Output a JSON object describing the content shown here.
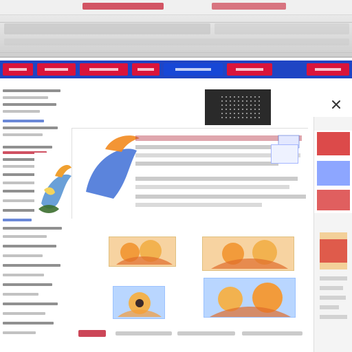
{
  "page": {
    "background": "#ffffff"
  },
  "colors": {
    "nav_blue": "#1f45c4",
    "nav_red": "#d9143b",
    "link_red": "#c3263b"
  },
  "header": {
    "top_tabs": [
      "tab-a",
      "tab-b",
      "tab-c"
    ]
  },
  "nav": {
    "items": [
      {
        "name": "nav-item-1",
        "color": "red"
      },
      {
        "name": "nav-item-2",
        "color": "red"
      },
      {
        "name": "nav-item-3",
        "color": "red"
      },
      {
        "name": "nav-item-4",
        "color": "red"
      },
      {
        "name": "nav-item-5",
        "color": "blue"
      },
      {
        "name": "nav-item-6",
        "color": "red"
      },
      {
        "name": "nav-item-7",
        "color": "red"
      }
    ]
  },
  "icons": {
    "close": "close-icon",
    "feature_badge": "badge-icon",
    "bird": "bird-icon"
  }
}
